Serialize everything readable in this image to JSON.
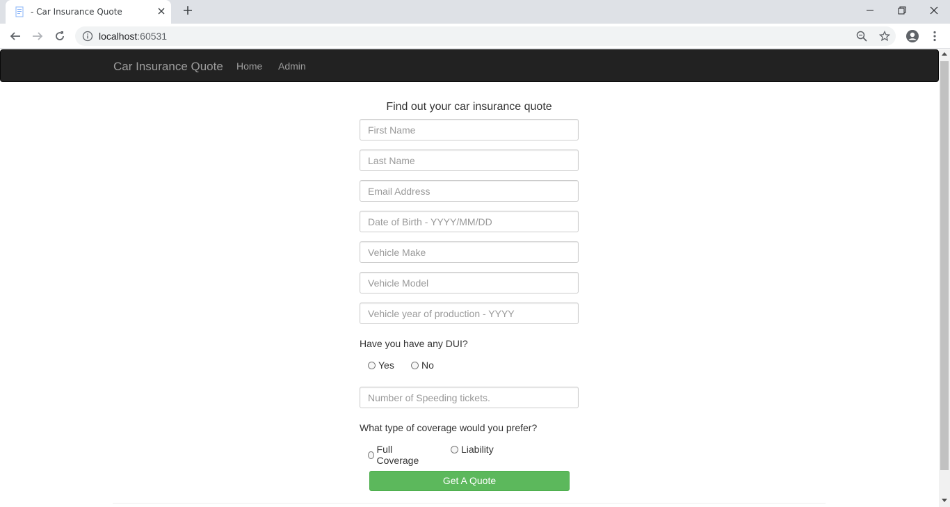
{
  "browser": {
    "tab_title": "- Car Insurance Quote",
    "url_host": "localhost",
    "url_port": ":60531"
  },
  "navbar": {
    "brand": "Car Insurance Quote",
    "links": [
      "Home",
      "Admin"
    ]
  },
  "form": {
    "title": "Find out your car insurance quote",
    "placeholders": {
      "first_name": "First Name",
      "last_name": "Last Name",
      "email": "Email Address",
      "dob": "Date of Birth - YYYY/MM/DD",
      "make": "Vehicle Make",
      "model": "Vehicle Model",
      "year": "Vehicle year of production - YYYY",
      "tickets": "Number of Speeding tickets."
    },
    "dui_question": "Have you have any DUI?",
    "dui_options": [
      "Yes",
      "No"
    ],
    "coverage_question": "What type of coverage would you prefer?",
    "coverage_options": [
      "Full Coverage",
      "Liability"
    ],
    "submit_label": "Get A Quote"
  },
  "colors": {
    "navbar_bg": "#222222",
    "submit_bg": "#5cb85c"
  }
}
